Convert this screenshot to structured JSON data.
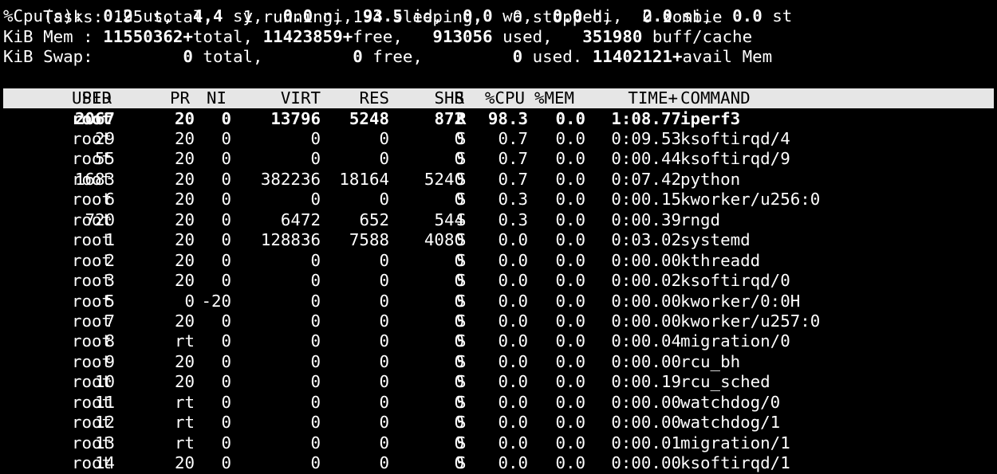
{
  "summary": {
    "cut_top_text": "Tasks: 195 total,   1 running, 194 sleeping,   0 stopped,   0 zombie",
    "cpu": {
      "prefix": "%Cpu(s):",
      "us": "0.2",
      "us_label": " us,",
      "sy": "4.4",
      "sy_label": " sy,",
      "ni": "0.0",
      "ni_label": " ni,",
      "id": "93.5",
      "id_label": " id,",
      "wa": "0.0",
      "wa_label": " wa,",
      "hi": "0.0",
      "hi_label": " hi,",
      "si": "2.0",
      "si_label": " si,",
      "st": "0.0",
      "st_label": " st"
    },
    "mem": {
      "prefix": "KiB Mem : ",
      "total": "11550362+",
      "total_label": "total, ",
      "free": "11423859+",
      "free_label": "free,   ",
      "used": "913056",
      "used_label": " used,   ",
      "buff": "351980",
      "buff_label": " buff/cache"
    },
    "swap": {
      "prefix": "KiB Swap:         ",
      "total": "0",
      "total_label": " total,         ",
      "free": "0",
      "free_label": " free,         ",
      "used": "0",
      "used_label": " used. ",
      "avail": "11402121+",
      "avail_label": "avail Mem"
    }
  },
  "columns": [
    "PID",
    "USER",
    "PR",
    "NI",
    "VIRT",
    "RES",
    "SHR",
    "S",
    "%CPU",
    "%MEM",
    "TIME+",
    "COMMAND"
  ],
  "processes": [
    {
      "pid": "2067",
      "user": "root",
      "pr": "20",
      "ni": "0",
      "virt": "13796",
      "res": "5248",
      "shr": "872",
      "s": "R",
      "cpu": "98.3",
      "mem": "0.0",
      "time": "1:08.77",
      "cmd": "iperf3",
      "highlight": true
    },
    {
      "pid": "29",
      "user": "root",
      "pr": "20",
      "ni": "0",
      "virt": "0",
      "res": "0",
      "shr": "0",
      "s": "S",
      "cpu": "0.7",
      "mem": "0.0",
      "time": "0:09.53",
      "cmd": "ksoftirqd/4"
    },
    {
      "pid": "55",
      "user": "root",
      "pr": "20",
      "ni": "0",
      "virt": "0",
      "res": "0",
      "shr": "0",
      "s": "S",
      "cpu": "0.7",
      "mem": "0.0",
      "time": "0:00.44",
      "cmd": "ksoftirqd/9"
    },
    {
      "pid": "1683",
      "user": "root",
      "pr": "20",
      "ni": "0",
      "virt": "382236",
      "res": "18164",
      "shr": "5240",
      "s": "S",
      "cpu": "0.7",
      "mem": "0.0",
      "time": "0:07.42",
      "cmd": "python"
    },
    {
      "pid": "6",
      "user": "root",
      "pr": "20",
      "ni": "0",
      "virt": "0",
      "res": "0",
      "shr": "0",
      "s": "S",
      "cpu": "0.3",
      "mem": "0.0",
      "time": "0:00.15",
      "cmd": "kworker/u256:0"
    },
    {
      "pid": "720",
      "user": "root",
      "pr": "20",
      "ni": "0",
      "virt": "6472",
      "res": "652",
      "shr": "544",
      "s": "S",
      "cpu": "0.3",
      "mem": "0.0",
      "time": "0:00.39",
      "cmd": "rngd"
    },
    {
      "pid": "1",
      "user": "root",
      "pr": "20",
      "ni": "0",
      "virt": "128836",
      "res": "7588",
      "shr": "4080",
      "s": "S",
      "cpu": "0.0",
      "mem": "0.0",
      "time": "0:03.02",
      "cmd": "systemd"
    },
    {
      "pid": "2",
      "user": "root",
      "pr": "20",
      "ni": "0",
      "virt": "0",
      "res": "0",
      "shr": "0",
      "s": "S",
      "cpu": "0.0",
      "mem": "0.0",
      "time": "0:00.00",
      "cmd": "kthreadd"
    },
    {
      "pid": "3",
      "user": "root",
      "pr": "20",
      "ni": "0",
      "virt": "0",
      "res": "0",
      "shr": "0",
      "s": "S",
      "cpu": "0.0",
      "mem": "0.0",
      "time": "0:00.02",
      "cmd": "ksoftirqd/0"
    },
    {
      "pid": "5",
      "user": "root",
      "pr": "0",
      "ni": "-20",
      "virt": "0",
      "res": "0",
      "shr": "0",
      "s": "S",
      "cpu": "0.0",
      "mem": "0.0",
      "time": "0:00.00",
      "cmd": "kworker/0:0H"
    },
    {
      "pid": "7",
      "user": "root",
      "pr": "20",
      "ni": "0",
      "virt": "0",
      "res": "0",
      "shr": "0",
      "s": "S",
      "cpu": "0.0",
      "mem": "0.0",
      "time": "0:00.00",
      "cmd": "kworker/u257:0"
    },
    {
      "pid": "8",
      "user": "root",
      "pr": "rt",
      "ni": "0",
      "virt": "0",
      "res": "0",
      "shr": "0",
      "s": "S",
      "cpu": "0.0",
      "mem": "0.0",
      "time": "0:00.04",
      "cmd": "migration/0"
    },
    {
      "pid": "9",
      "user": "root",
      "pr": "20",
      "ni": "0",
      "virt": "0",
      "res": "0",
      "shr": "0",
      "s": "S",
      "cpu": "0.0",
      "mem": "0.0",
      "time": "0:00.00",
      "cmd": "rcu_bh"
    },
    {
      "pid": "10",
      "user": "root",
      "pr": "20",
      "ni": "0",
      "virt": "0",
      "res": "0",
      "shr": "0",
      "s": "S",
      "cpu": "0.0",
      "mem": "0.0",
      "time": "0:00.19",
      "cmd": "rcu_sched"
    },
    {
      "pid": "11",
      "user": "root",
      "pr": "rt",
      "ni": "0",
      "virt": "0",
      "res": "0",
      "shr": "0",
      "s": "S",
      "cpu": "0.0",
      "mem": "0.0",
      "time": "0:00.00",
      "cmd": "watchdog/0"
    },
    {
      "pid": "12",
      "user": "root",
      "pr": "rt",
      "ni": "0",
      "virt": "0",
      "res": "0",
      "shr": "0",
      "s": "S",
      "cpu": "0.0",
      "mem": "0.0",
      "time": "0:00.00",
      "cmd": "watchdog/1"
    },
    {
      "pid": "13",
      "user": "root",
      "pr": "rt",
      "ni": "0",
      "virt": "0",
      "res": "0",
      "shr": "0",
      "s": "S",
      "cpu": "0.0",
      "mem": "0.0",
      "time": "0:00.01",
      "cmd": "migration/1"
    },
    {
      "pid": "14",
      "user": "root",
      "pr": "20",
      "ni": "0",
      "virt": "0",
      "res": "0",
      "shr": "0",
      "s": "S",
      "cpu": "0.0",
      "mem": "0.0",
      "time": "0:00.00",
      "cmd": "ksoftirqd/1"
    }
  ],
  "colors": {
    "background": "#000000",
    "foreground": "#ffffff",
    "header_bg": "#e6e6e6",
    "header_fg": "#000000"
  }
}
